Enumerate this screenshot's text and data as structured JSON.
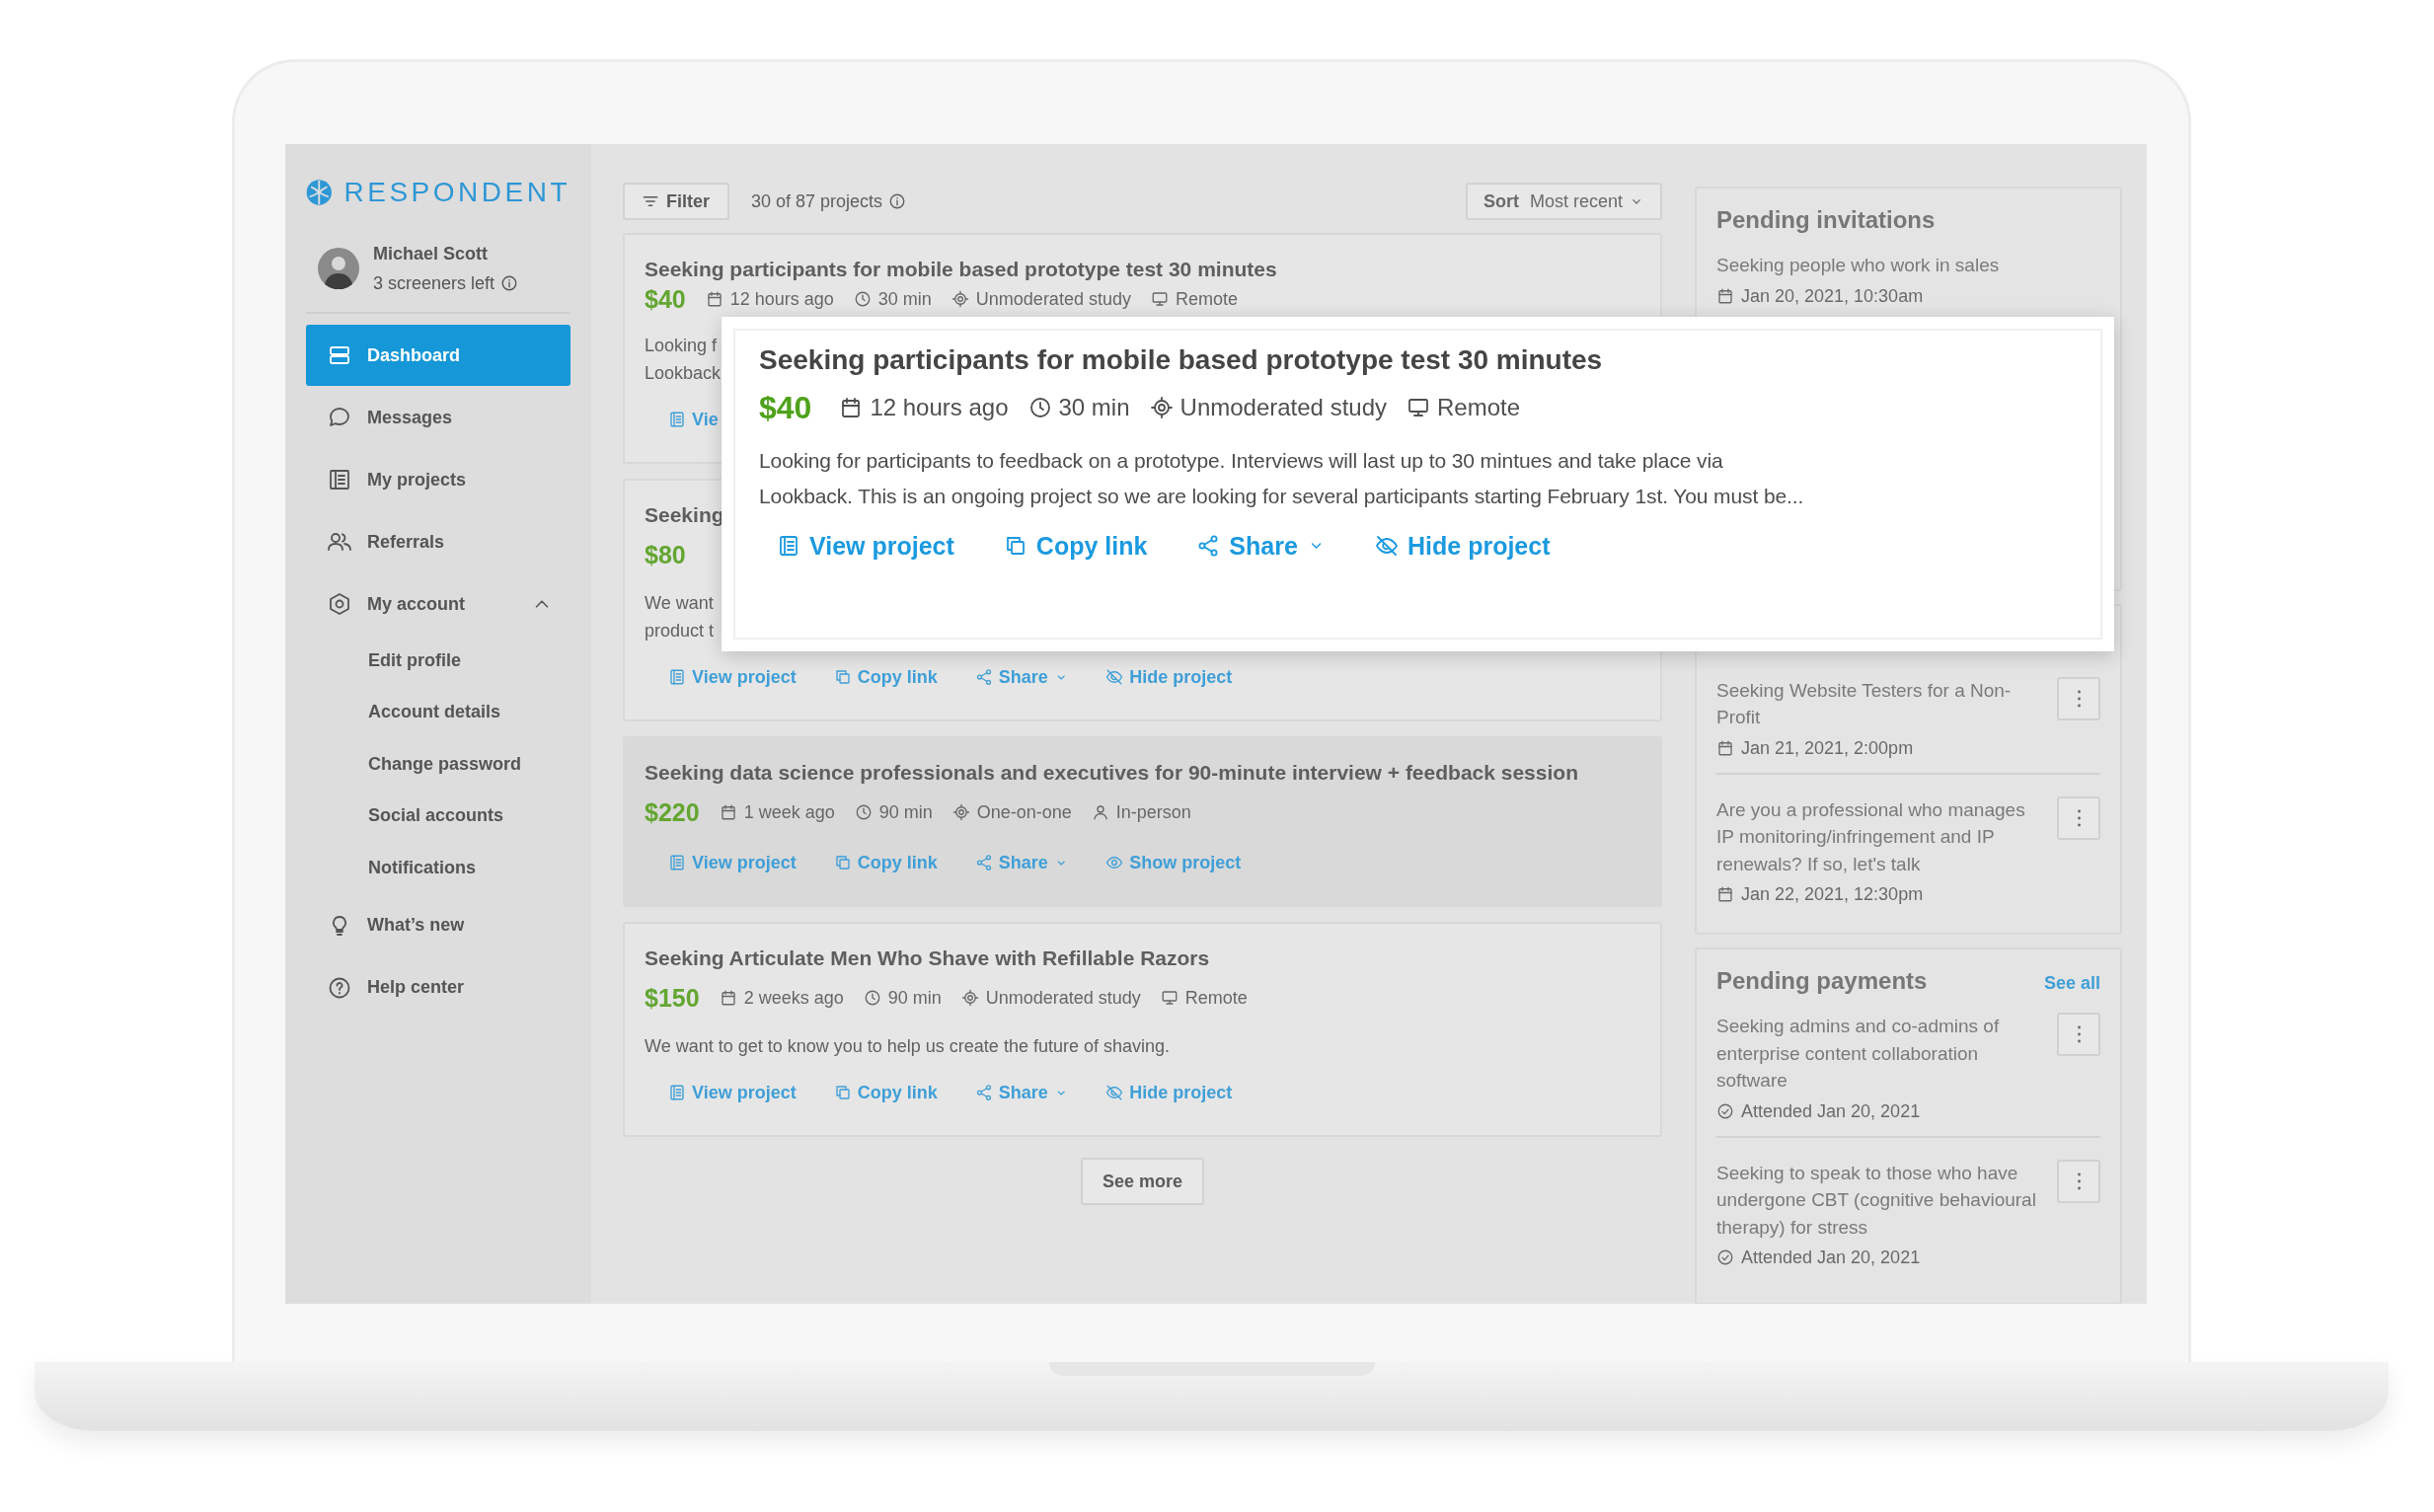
{
  "brand": {
    "name": "RESPONDENT"
  },
  "user": {
    "name": "Michael Scott",
    "screeners": "3 screeners left"
  },
  "nav": [
    {
      "label": "Dashboard",
      "selected": true
    },
    {
      "label": "Messages",
      "selected": false
    },
    {
      "label": "My projects",
      "selected": false
    },
    {
      "label": "Referrals",
      "selected": false
    },
    {
      "label": "My account",
      "selected": false,
      "expanded": true,
      "children": [
        {
          "label": "Edit profile"
        },
        {
          "label": "Account details"
        },
        {
          "label": "Change password"
        },
        {
          "label": "Social accounts"
        },
        {
          "label": "Notifications"
        }
      ]
    },
    {
      "label": "What’s new",
      "selected": false
    },
    {
      "label": "Help center",
      "selected": false
    }
  ],
  "toolbar": {
    "filter": "Filter",
    "count": "30 of 87 projects",
    "sort_label": "Sort",
    "sort_value": "Most recent"
  },
  "projects": [
    {
      "title": "Seeking participants for mobile based prototype test 30 minutes",
      "price": "$40",
      "hidden": false,
      "meta": [
        {
          "kind": "date",
          "text": "12 hours ago"
        },
        {
          "kind": "duration",
          "text": "30 min"
        },
        {
          "kind": "method",
          "text": "Unmoderated study"
        },
        {
          "kind": "remote",
          "text": "Remote"
        }
      ],
      "description_lines": [
        "Looking f",
        "Lookback"
      ],
      "actions": [
        {
          "kind": "view",
          "label": "Vie"
        }
      ]
    },
    {
      "title": "Seeking",
      "price": "$80",
      "hidden": false,
      "description_lines": [
        "We want",
        "product t"
      ],
      "actions": [
        {
          "kind": "view",
          "label": "View project"
        },
        {
          "kind": "copy",
          "label": "Copy link"
        },
        {
          "kind": "share",
          "label": "Share"
        },
        {
          "kind": "hide",
          "label": "Hide project"
        }
      ]
    },
    {
      "title": "Seeking data science professionals and executives for 90-minute interview + feedback session",
      "price": "$220",
      "hidden": true,
      "meta": [
        {
          "kind": "date",
          "text": "1 week ago"
        },
        {
          "kind": "duration",
          "text": "90 min"
        },
        {
          "kind": "method",
          "text": "One-on-one"
        },
        {
          "kind": "inperson",
          "text": "In-person"
        }
      ],
      "actions": [
        {
          "kind": "view",
          "label": "View project"
        },
        {
          "kind": "copy",
          "label": "Copy link"
        },
        {
          "kind": "share",
          "label": "Share"
        },
        {
          "kind": "show",
          "label": "Show project"
        }
      ]
    },
    {
      "title": "Seeking Articulate Men Who Shave with Refillable Razors",
      "price": "$150",
      "hidden": false,
      "meta": [
        {
          "kind": "date",
          "text": "2 weeks ago"
        },
        {
          "kind": "duration",
          "text": "90 min"
        },
        {
          "kind": "method",
          "text": "Unmoderated study"
        },
        {
          "kind": "remote",
          "text": "Remote"
        }
      ],
      "description_lines": [
        "We want to get to know you to help us create the future of shaving."
      ],
      "actions": [
        {
          "kind": "view",
          "label": "View project"
        },
        {
          "kind": "copy",
          "label": "Copy link"
        },
        {
          "kind": "share",
          "label": "Share"
        },
        {
          "kind": "hide",
          "label": "Hide project"
        }
      ]
    }
  ],
  "see_more": "See more",
  "side_cards": [
    {
      "title": "Pending invitations",
      "items": [
        {
          "title": "Seeking people who work in sales",
          "date": "Jan 20, 2021, 10:30am",
          "menu": false
        }
      ]
    },
    {
      "items": [
        {
          "title": "Seeking Website Testers for a Non-Profit",
          "date": "Jan 21, 2021, 2:00pm",
          "menu": true
        },
        {
          "title": "Are you a professional who manages IP monitoring/infringement and IP renewals? If so, let's talk",
          "date": "Jan 22, 2021, 12:30pm",
          "menu": true
        }
      ]
    },
    {
      "title": "Pending payments",
      "link": "See all",
      "items": [
        {
          "title": "Seeking admins and co-admins of enterprise content collaboration software",
          "status": "Attended Jan 20, 2021",
          "menu": true
        },
        {
          "title": "Seeking to speak to those who have undergone CBT (cognitive behavioural therapy) for stress",
          "status": "Attended Jan 20, 2021",
          "menu": true
        }
      ]
    }
  ],
  "popup": {
    "title": "Seeking participants for mobile based prototype test 30 minutes",
    "price": "$40",
    "meta": [
      {
        "kind": "date",
        "text": "12 hours ago"
      },
      {
        "kind": "duration",
        "text": "30 min"
      },
      {
        "kind": "method",
        "text": "Unmoderated study"
      },
      {
        "kind": "remote",
        "text": "Remote"
      }
    ],
    "description_lines": [
      "Looking for participants to feedback on a prototype. Interviews will last up to 30 mintues and take place via",
      "Lookback. This is an ongoing project so we are looking for several participants starting February 1st. You must be..."
    ],
    "actions": [
      {
        "kind": "view",
        "label": "View project"
      },
      {
        "kind": "copy",
        "label": "Copy link"
      },
      {
        "kind": "share",
        "label": "Share"
      },
      {
        "kind": "hide",
        "label": "Hide project"
      }
    ]
  }
}
